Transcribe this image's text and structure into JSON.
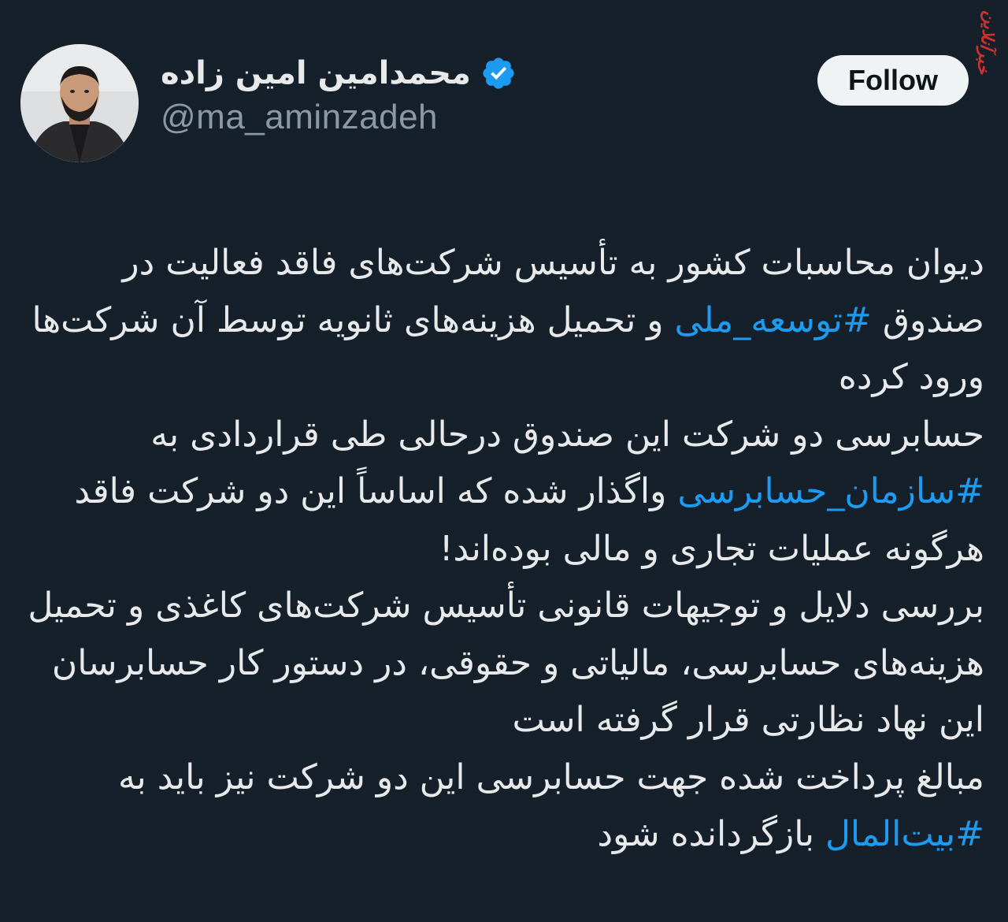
{
  "watermark": "خبرآنلاین",
  "user": {
    "display_name": "محمدامین امین زاده",
    "handle": "@ma_aminzadeh",
    "verified": true,
    "verified_color": "#1d9bf0"
  },
  "follow_button": {
    "label": "Follow"
  },
  "tweet": {
    "p1_a": "دیوان محاسبات کشور به تأسیس شرکت‌های فاقد فعالیت در صندوق ",
    "p1_tag": "#توسعه_ملی",
    "p1_b": " و تحمیل هزینه‌های ثانویه توسط آن شرکت‌ها ورود کرده",
    "p2_a": "حسابرسی دو شرکت این صندوق درحالی طی قراردادی به ",
    "p2_tag": "#سازمان_حسابرسی",
    "p2_b": " واگذار شده که اساساً این دو شرکت فاقد هرگونه عملیات تجاری و مالی بوده‌اند!",
    "p3": "بررسی دلایل و توجیهات قانونی تأسیس شرکت‌های کاغذی و تحمیل هزینه‌های حسابرسی، مالیاتی و حقوقی، در دستور کار حسابرسان این نهاد نظارتی قرار گرفته است",
    "p4_a": "مبالغ پرداخت شده جهت حسابرسی این دو شرکت نیز باید به ",
    "p4_tag": "#بیت‌المال",
    "p4_b": " بازگردانده شود"
  },
  "colors": {
    "background": "#15202b",
    "text": "#e7e9ea",
    "secondary": "#8b98a5",
    "link": "#1d9bf0",
    "watermark": "#d0312d"
  }
}
